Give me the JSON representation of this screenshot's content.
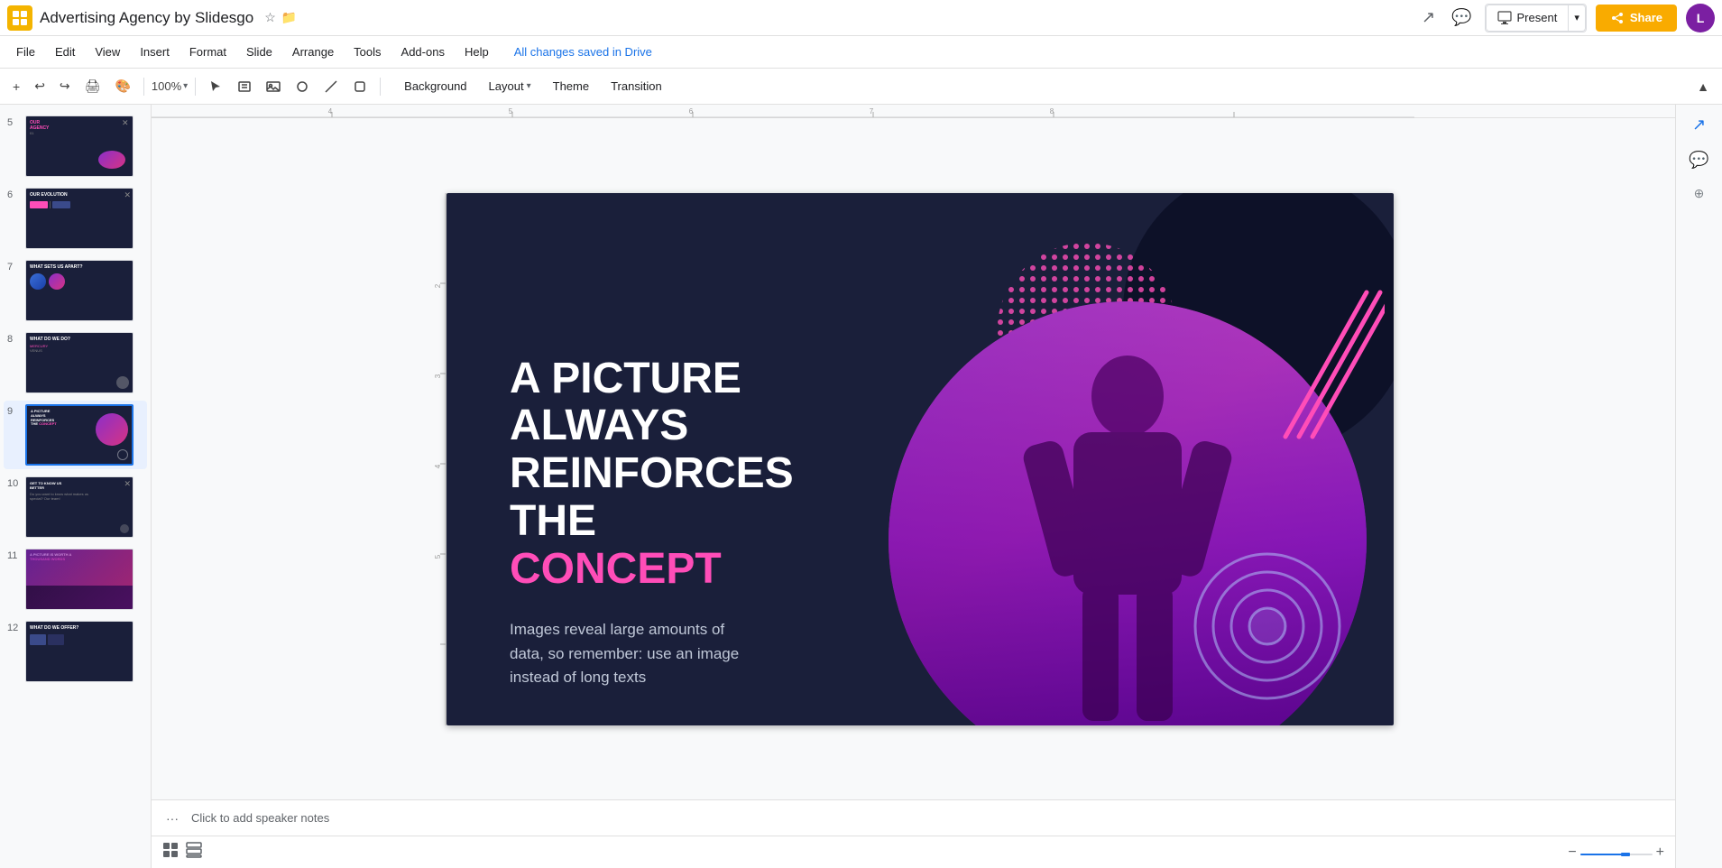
{
  "app": {
    "icon": "📊",
    "title": "Advertising Agency by Slidesgo",
    "saved_status": "All changes saved in Drive"
  },
  "menu": {
    "items": [
      "File",
      "Edit",
      "View",
      "Insert",
      "Format",
      "Slide",
      "Arrange",
      "Tools",
      "Add-ons",
      "Help"
    ]
  },
  "toolbar": {
    "zoom_level": "100%",
    "background_label": "Background",
    "layout_label": "Layout",
    "theme_label": "Theme",
    "transition_label": "Transition"
  },
  "header": {
    "present_label": "Present",
    "share_label": "Share",
    "avatar_initials": "L"
  },
  "slides": [
    {
      "num": "5",
      "bg": "#1a1f3a"
    },
    {
      "num": "6",
      "bg": "#1a1f3a"
    },
    {
      "num": "7",
      "bg": "#1a1f3a"
    },
    {
      "num": "8",
      "bg": "#1a1f3a"
    },
    {
      "num": "9",
      "bg": "#1a1f3a",
      "active": true
    },
    {
      "num": "10",
      "bg": "#1a1f3a"
    },
    {
      "num": "11",
      "bg": "#2a1540"
    },
    {
      "num": "12",
      "bg": "#1a1f3a"
    }
  ],
  "slide_content": {
    "heading_line1": "A PICTURE",
    "heading_line2": "ALWAYS",
    "heading_line3": "REINFORCES",
    "heading_line4_prefix": "THE ",
    "heading_line4_highlight": "CONCEPT",
    "body_text": "Images reveal large amounts of data, so remember: use an image instead of long texts"
  },
  "notes": {
    "placeholder": "Click to add speaker notes"
  },
  "colors": {
    "bg_dark": "#1a1f3a",
    "accent_pink": "#ff4db8",
    "accent_yellow": "#f9ab00",
    "slide_active_border": "#1a73e8"
  }
}
